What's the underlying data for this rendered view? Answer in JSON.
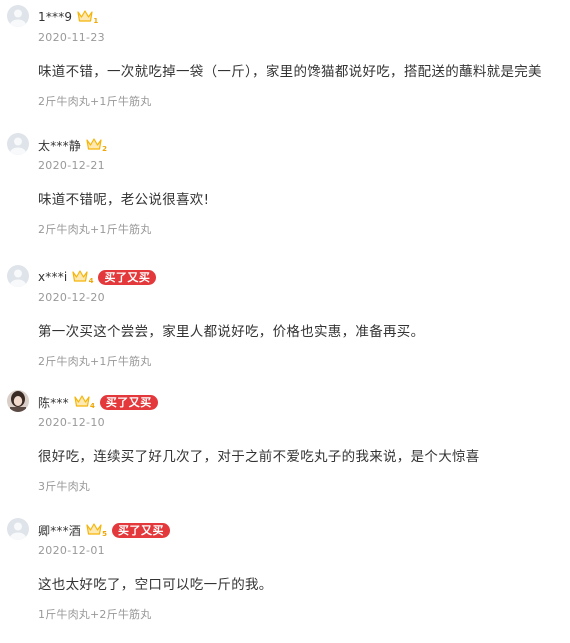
{
  "reviews": [
    {
      "username": "1***9",
      "vip_level": "1",
      "rebuy_label": "",
      "date": "2020-11-23",
      "content": "味道不错，一次就吃掉一袋（一斤），家里的馋猫都说好吃，搭配送的蘸料就是完美",
      "spec": "2斤牛肉丸+1斤牛筋丸",
      "avatar": "default-avatar"
    },
    {
      "username": "太***静",
      "vip_level": "2",
      "rebuy_label": "",
      "date": "2020-12-21",
      "content": "味道不错呢，老公说很喜欢!",
      "spec": "2斤牛肉丸+1斤牛筋丸",
      "avatar": "default-avatar"
    },
    {
      "username": "x***i",
      "vip_level": "4",
      "rebuy_label": "买了又买",
      "date": "2020-12-20",
      "content": "第一次买这个尝尝，家里人都说好吃，价格也实惠，准备再买。",
      "spec": "2斤牛肉丸+1斤牛筋丸",
      "avatar": "default-avatar"
    },
    {
      "username": "陈***",
      "vip_level": "4",
      "rebuy_label": "买了又买",
      "date": "2020-12-10",
      "content": "很好吃，连续买了好几次了，对于之前不爱吃丸子的我来说，是个大惊喜",
      "spec": "3斤牛肉丸",
      "avatar": "photo-avatar"
    },
    {
      "username": "卿***酒",
      "vip_level": "5",
      "rebuy_label": "买了又买",
      "date": "2020-12-01",
      "content": "这也太好吃了，空口可以吃一斤的我。",
      "spec": "1斤牛肉丸+2斤牛筋丸",
      "avatar": "default-avatar"
    }
  ],
  "colors": {
    "rebuy_badge": "#e4393c",
    "vip_badge": "#f5b50a",
    "meta_text": "#999999",
    "main_text": "#333333"
  }
}
